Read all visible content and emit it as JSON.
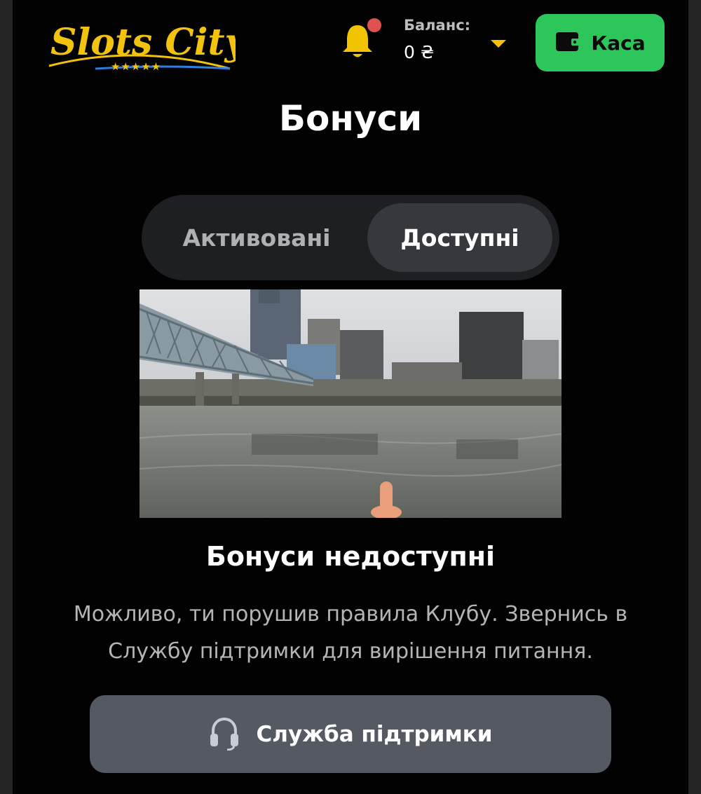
{
  "header": {
    "logo_text": "Slots City",
    "logo_stars": "★★★★★",
    "notifications_icon": "bell-icon",
    "balance_label": "Баланс:",
    "balance_value": "0 ₴",
    "balance_dropdown_icon": "caret-down-icon",
    "cashier_label": "Каса",
    "cashier_icon": "wallet-icon"
  },
  "main": {
    "title": "Бонуси",
    "tabs": [
      {
        "label": "Активовані",
        "selected": false
      },
      {
        "label": "Доступні",
        "selected": true
      }
    ],
    "empty_state": {
      "title": "Бонуси недоступні",
      "description": "Можливо, ти порушив правила Клубу. Звернись в Службу підтримки для вирішення питання."
    },
    "support_button": {
      "label": "Служба підтримки",
      "icon": "headset-icon"
    }
  },
  "colors": {
    "background": "#020202",
    "accent_green": "#2cc65a",
    "bell_yellow": "#f2c300",
    "notification_dot": "#e05252",
    "logo_gold": "#f3c20f"
  }
}
